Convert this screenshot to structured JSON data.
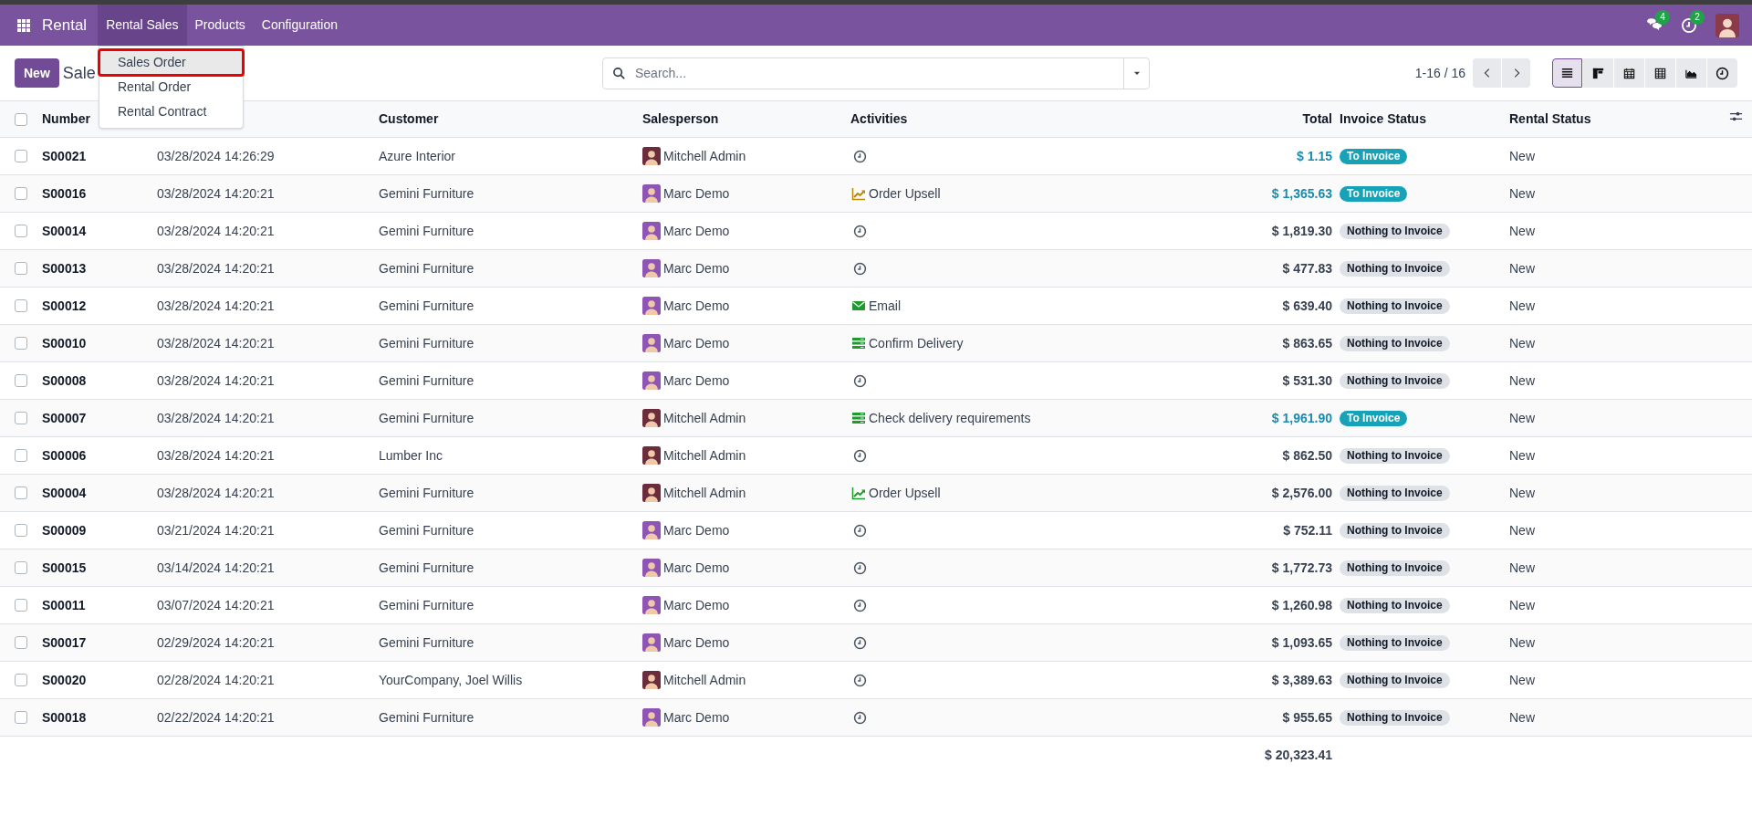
{
  "navbar": {
    "app_name": "Rental",
    "menus": [
      {
        "label": "Rental Sales",
        "selected": true
      },
      {
        "label": "Products",
        "selected": false
      },
      {
        "label": "Configuration",
        "selected": false
      }
    ],
    "messages_count": "4",
    "activities_count": "2"
  },
  "dropdown": {
    "items": [
      {
        "label": "Sales Order",
        "selected": true
      },
      {
        "label": "Rental Order",
        "selected": false
      },
      {
        "label": "Rental Contract",
        "selected": false
      }
    ]
  },
  "control_panel": {
    "new_button": "New",
    "breadcrumb": "Sale",
    "search": {
      "placeholder": "Search..."
    },
    "pager": "1-16 / 16",
    "views": [
      {
        "kind": "list",
        "selected": true
      },
      {
        "kind": "kanban",
        "selected": false
      },
      {
        "kind": "calendar",
        "selected": false
      },
      {
        "kind": "pivot",
        "selected": false
      },
      {
        "kind": "graph",
        "selected": false
      },
      {
        "kind": "activity",
        "selected": false
      }
    ]
  },
  "table": {
    "all_selected": false,
    "columns": [
      "Number",
      "Customer",
      "Salesperson",
      "Activities",
      "Total",
      "Invoice Status",
      "Rental Status"
    ],
    "rows": [
      {
        "checked": false,
        "number": "S00021",
        "date": "03/28/2024 14:26:29",
        "customer": "Azure Interior",
        "salesperson": {
          "name": "Mitchell Admin",
          "color": "#6b2d3c"
        },
        "activity": {
          "kind": "none"
        },
        "total": "$ 1.15",
        "invoice_status": {
          "label": "To Invoice",
          "kind": "to_invoice"
        },
        "rental_status": "New"
      },
      {
        "checked": false,
        "number": "S00016",
        "date": "03/28/2024 14:20:21",
        "customer": "Gemini Furniture",
        "salesperson": {
          "name": "Marc Demo",
          "color": "#8e55b5"
        },
        "activity": {
          "kind": "upsell",
          "label": "Order Upsell",
          "color": "#b8860b"
        },
        "total": "$ 1,365.63",
        "invoice_status": {
          "label": "To Invoice",
          "kind": "to_invoice"
        },
        "rental_status": "New"
      },
      {
        "checked": false,
        "number": "S00014",
        "date": "03/28/2024 14:20:21",
        "customer": "Gemini Furniture",
        "salesperson": {
          "name": "Marc Demo",
          "color": "#8e55b5"
        },
        "activity": {
          "kind": "none"
        },
        "total": "$ 1,819.30",
        "invoice_status": {
          "label": "Nothing to Invoice",
          "kind": "nothing"
        },
        "rental_status": "New"
      },
      {
        "checked": false,
        "number": "S00013",
        "date": "03/28/2024 14:20:21",
        "customer": "Gemini Furniture",
        "salesperson": {
          "name": "Marc Demo",
          "color": "#8e55b5"
        },
        "activity": {
          "kind": "none"
        },
        "total": "$ 477.83",
        "invoice_status": {
          "label": "Nothing to Invoice",
          "kind": "nothing"
        },
        "rental_status": "New"
      },
      {
        "checked": false,
        "number": "S00012",
        "date": "03/28/2024 14:20:21",
        "customer": "Gemini Furniture",
        "salesperson": {
          "name": "Marc Demo",
          "color": "#8e55b5"
        },
        "activity": {
          "kind": "email",
          "label": "Email",
          "color": "#1e9a2f"
        },
        "total": "$ 639.40",
        "invoice_status": {
          "label": "Nothing to Invoice",
          "kind": "nothing"
        },
        "rental_status": "New"
      },
      {
        "checked": false,
        "number": "S00010",
        "date": "03/28/2024 14:20:21",
        "customer": "Gemini Furniture",
        "salesperson": {
          "name": "Marc Demo",
          "color": "#8e55b5"
        },
        "activity": {
          "kind": "delivery",
          "label": "Confirm Delivery",
          "color": "#1e9a2f"
        },
        "total": "$ 863.65",
        "invoice_status": {
          "label": "Nothing to Invoice",
          "kind": "nothing"
        },
        "rental_status": "New"
      },
      {
        "checked": false,
        "number": "S00008",
        "date": "03/28/2024 14:20:21",
        "customer": "Gemini Furniture",
        "salesperson": {
          "name": "Marc Demo",
          "color": "#8e55b5"
        },
        "activity": {
          "kind": "none"
        },
        "total": "$ 531.30",
        "invoice_status": {
          "label": "Nothing to Invoice",
          "kind": "nothing"
        },
        "rental_status": "New"
      },
      {
        "checked": false,
        "number": "S00007",
        "date": "03/28/2024 14:20:21",
        "customer": "Gemini Furniture",
        "salesperson": {
          "name": "Mitchell Admin",
          "color": "#6b2d3c"
        },
        "activity": {
          "kind": "delivery",
          "label": "Check delivery requirements",
          "color": "#1e9a2f"
        },
        "total": "$ 1,961.90",
        "invoice_status": {
          "label": "To Invoice",
          "kind": "to_invoice"
        },
        "rental_status": "New"
      },
      {
        "checked": false,
        "number": "S00006",
        "date": "03/28/2024 14:20:21",
        "customer": "Lumber Inc",
        "salesperson": {
          "name": "Mitchell Admin",
          "color": "#6b2d3c"
        },
        "activity": {
          "kind": "none"
        },
        "total": "$ 862.50",
        "invoice_status": {
          "label": "Nothing to Invoice",
          "kind": "nothing"
        },
        "rental_status": "New"
      },
      {
        "checked": false,
        "number": "S00004",
        "date": "03/28/2024 14:20:21",
        "customer": "Gemini Furniture",
        "salesperson": {
          "name": "Mitchell Admin",
          "color": "#6b2d3c"
        },
        "activity": {
          "kind": "upsell",
          "label": "Order Upsell",
          "color": "#1e9a2f"
        },
        "total": "$ 2,576.00",
        "invoice_status": {
          "label": "Nothing to Invoice",
          "kind": "nothing"
        },
        "rental_status": "New"
      },
      {
        "checked": false,
        "number": "S00009",
        "date": "03/21/2024 14:20:21",
        "customer": "Gemini Furniture",
        "salesperson": {
          "name": "Marc Demo",
          "color": "#8e55b5"
        },
        "activity": {
          "kind": "none"
        },
        "total": "$ 752.11",
        "invoice_status": {
          "label": "Nothing to Invoice",
          "kind": "nothing"
        },
        "rental_status": "New"
      },
      {
        "checked": false,
        "number": "S00015",
        "date": "03/14/2024 14:20:21",
        "customer": "Gemini Furniture",
        "salesperson": {
          "name": "Marc Demo",
          "color": "#8e55b5"
        },
        "activity": {
          "kind": "none"
        },
        "total": "$ 1,772.73",
        "invoice_status": {
          "label": "Nothing to Invoice",
          "kind": "nothing"
        },
        "rental_status": "New"
      },
      {
        "checked": false,
        "number": "S00011",
        "date": "03/07/2024 14:20:21",
        "customer": "Gemini Furniture",
        "salesperson": {
          "name": "Marc Demo",
          "color": "#8e55b5"
        },
        "activity": {
          "kind": "none"
        },
        "total": "$ 1,260.98",
        "invoice_status": {
          "label": "Nothing to Invoice",
          "kind": "nothing"
        },
        "rental_status": "New"
      },
      {
        "checked": false,
        "number": "S00017",
        "date": "02/29/2024 14:20:21",
        "customer": "Gemini Furniture",
        "salesperson": {
          "name": "Marc Demo",
          "color": "#8e55b5"
        },
        "activity": {
          "kind": "none"
        },
        "total": "$ 1,093.65",
        "invoice_status": {
          "label": "Nothing to Invoice",
          "kind": "nothing"
        },
        "rental_status": "New"
      },
      {
        "checked": false,
        "number": "S00020",
        "date": "02/28/2024 14:20:21",
        "customer": "YourCompany, Joel Willis",
        "salesperson": {
          "name": "Mitchell Admin",
          "color": "#6b2d3c"
        },
        "activity": {
          "kind": "none"
        },
        "total": "$ 3,389.63",
        "invoice_status": {
          "label": "Nothing to Invoice",
          "kind": "nothing"
        },
        "rental_status": "New"
      },
      {
        "checked": false,
        "number": "S00018",
        "date": "02/22/2024 14:20:21",
        "customer": "Gemini Furniture",
        "salesperson": {
          "name": "Marc Demo",
          "color": "#8e55b5"
        },
        "activity": {
          "kind": "none"
        },
        "total": "$ 955.65",
        "invoice_status": {
          "label": "Nothing to Invoice",
          "kind": "nothing"
        },
        "rental_status": "New"
      }
    ],
    "grand_total": "$ 20,323.41"
  }
}
